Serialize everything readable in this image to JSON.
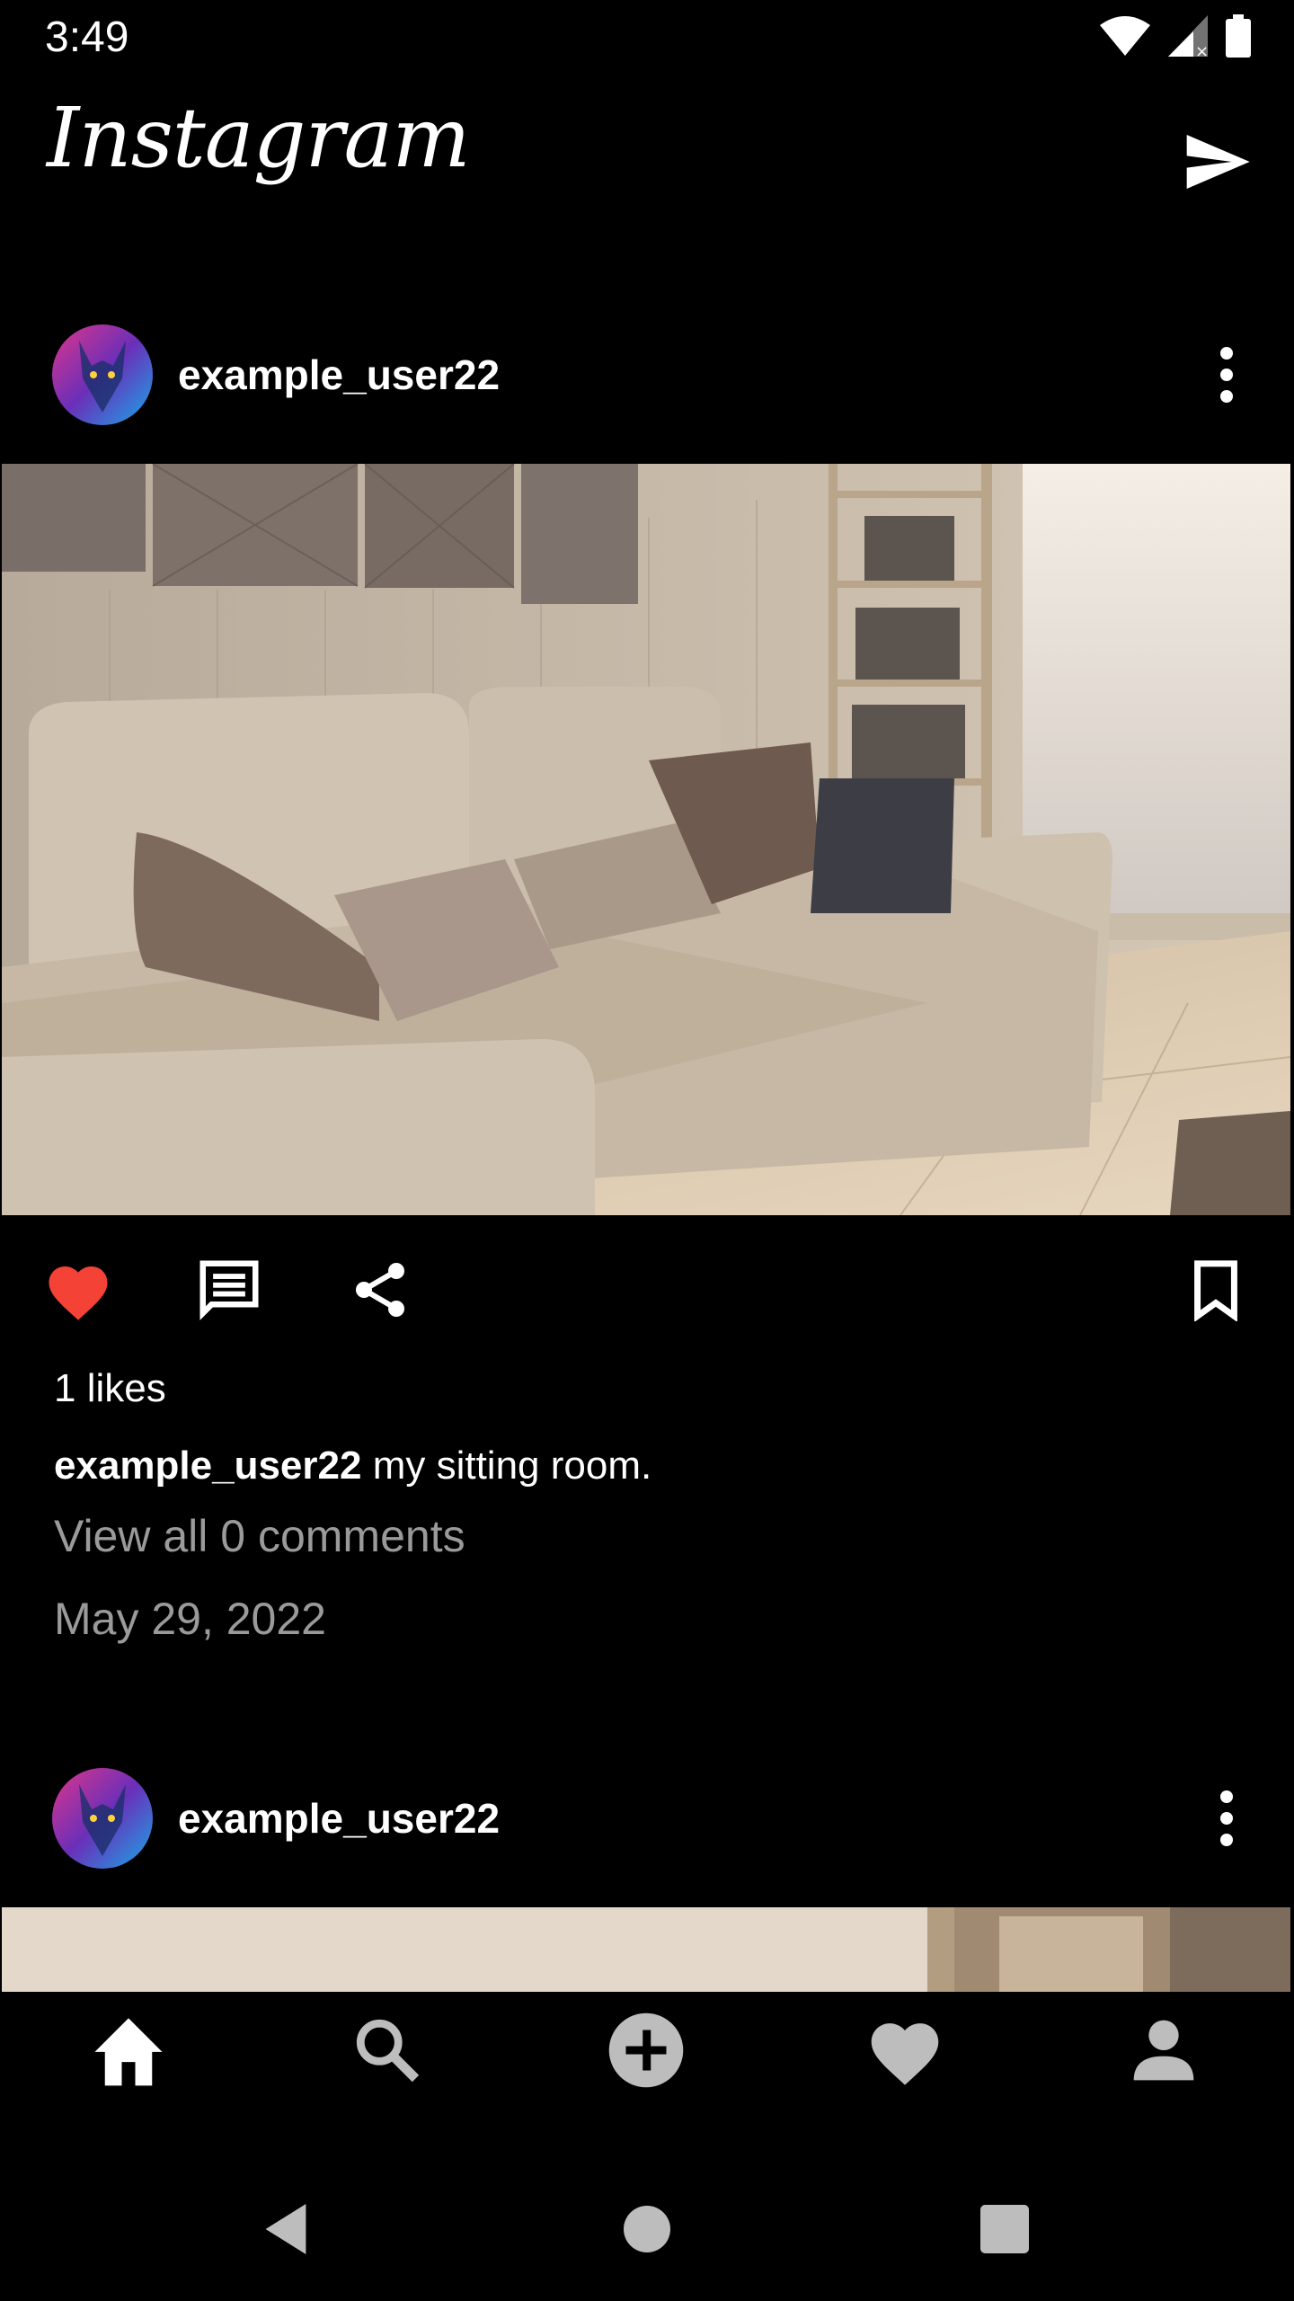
{
  "status_bar": {
    "time": "3:49"
  },
  "app_bar": {
    "title": "Instagram"
  },
  "posts": [
    {
      "username": "example_user22",
      "likes_text": "1 likes",
      "caption_user": "example_user22",
      "caption_text": " my sitting room.",
      "comments_text": "View all 0 comments",
      "date": "May 29, 2022",
      "liked": true
    },
    {
      "username": "example_user22"
    }
  ],
  "colors": {
    "like_active": "#f44336",
    "muted_text": "#9a9a9a",
    "background": "#000000"
  },
  "icons": {
    "app_bar": [
      "send-icon"
    ],
    "actions": [
      "heart-icon",
      "comment-icon",
      "share-icon",
      "bookmark-icon"
    ],
    "bottom_nav": [
      "home-icon",
      "search-icon",
      "add-icon",
      "heart-icon",
      "profile-icon"
    ],
    "system_nav": [
      "back-icon",
      "home-circle-icon",
      "recents-icon"
    ]
  }
}
